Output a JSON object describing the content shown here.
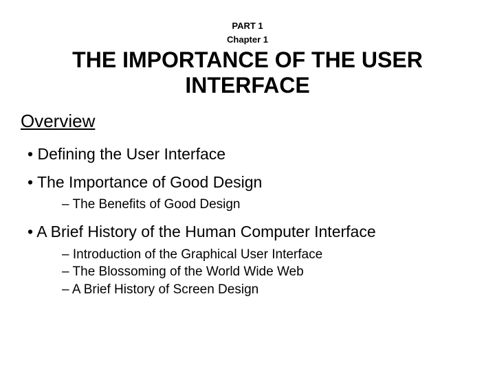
{
  "header": {
    "part": "PART 1",
    "chapter": "Chapter 1",
    "title": "THE IMPORTANCE OF THE USER INTERFACE"
  },
  "section": "Overview",
  "items": [
    {
      "text": "Defining the User Interface",
      "sub": []
    },
    {
      "text": "The Importance of Good Design",
      "sub": [
        "The Benefits of Good Design"
      ]
    },
    {
      "text": "A Brief History of the Human Computer Interface",
      "sub": [
        "Introduction of the Graphical User Interface",
        "The Blossoming of the World Wide Web",
        "A Brief History of Screen Design"
      ]
    }
  ]
}
